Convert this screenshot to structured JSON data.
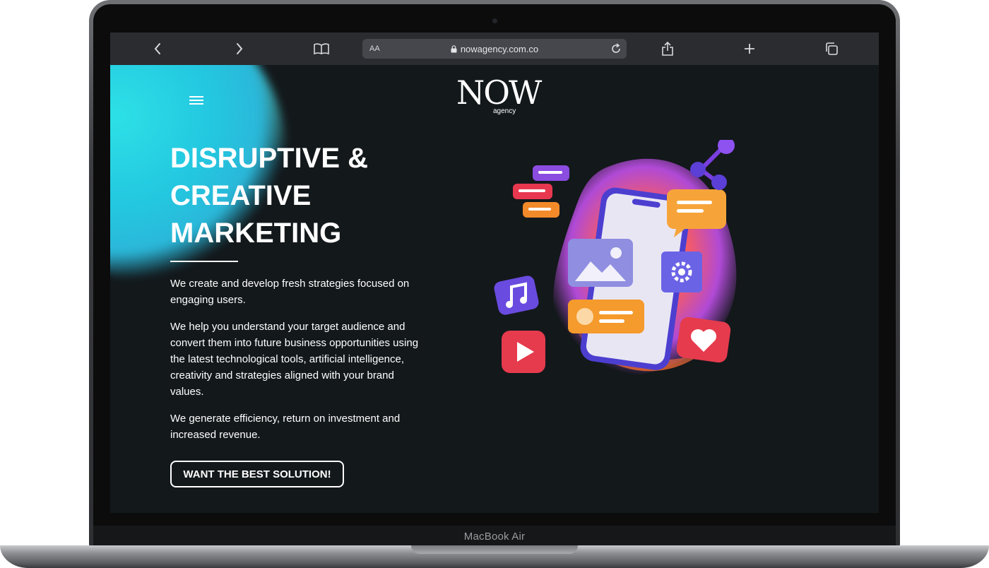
{
  "device": {
    "label": "MacBook Air"
  },
  "browser": {
    "url": "nowagency.com.co",
    "text_size_label": "AA",
    "icons": [
      "back-icon",
      "forward-icon",
      "bookmarks-icon",
      "lock-icon",
      "reload-icon",
      "share-icon",
      "new-tab-icon",
      "tabs-icon"
    ]
  },
  "site": {
    "logo": {
      "main": "NOW",
      "sub": "agency"
    },
    "menu_icon": "hamburger-menu-icon",
    "hero": {
      "title_lines": [
        "DISRUPTIVE &",
        "CREATIVE",
        "MARKETING"
      ],
      "paragraphs": [
        "We create and develop fresh strategies focused on engaging users.",
        "We help you understand your target audience and convert them into future business opportunities using the latest technological tools, artificial intelligence, creativity and strategies aligned with your brand values.",
        "We generate efficiency, return on investment and increased revenue."
      ],
      "cta_label": "WANT THE BEST SOLUTION!"
    }
  },
  "colors": {
    "page_bg": "#13181b",
    "toolbar_bg": "#2a2c30",
    "accent_cyan": "#2de0e6",
    "accent_orange": "#f4a030",
    "accent_purple": "#8b5cf6",
    "accent_red": "#e8384f"
  }
}
